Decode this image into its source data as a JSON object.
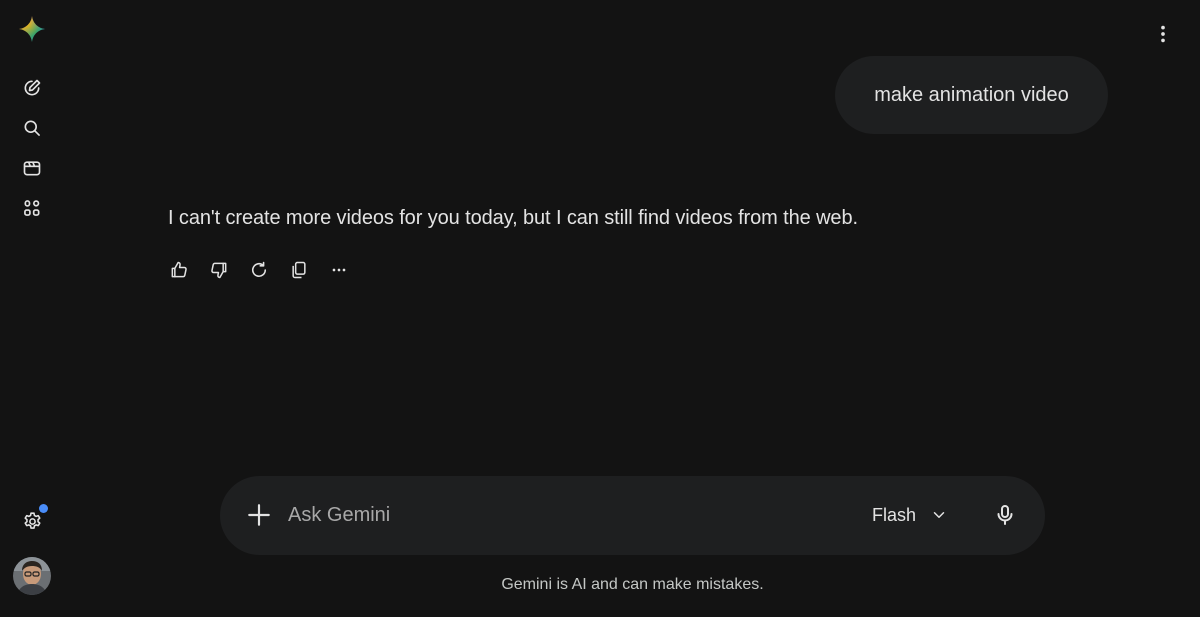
{
  "sidebar": {
    "logo_icon": "gemini-sparkle-icon",
    "items": [
      {
        "icon": "new-chat-icon"
      },
      {
        "icon": "search-icon"
      },
      {
        "icon": "videos-icon"
      },
      {
        "icon": "apps-icon"
      }
    ],
    "settings_icon": "gear-icon",
    "notification_color": "#4a8df8"
  },
  "header": {
    "more_icon": "more-vert-icon"
  },
  "conversation": {
    "user_message": "make animation video",
    "response": "I can't create more videos for you today, but I can still find videos from the web.",
    "actions": [
      "thumbs-up-icon",
      "thumbs-down-icon",
      "regenerate-icon",
      "copy-icon",
      "more-horiz-icon"
    ]
  },
  "composer": {
    "placeholder": "Ask Gemini",
    "value": "",
    "model": "Flash",
    "disclaimer": "Gemini is AI and can make mistakes."
  },
  "colors": {
    "background": "#131313",
    "surface": "#1e1f20",
    "text": "#e3e3e3"
  }
}
